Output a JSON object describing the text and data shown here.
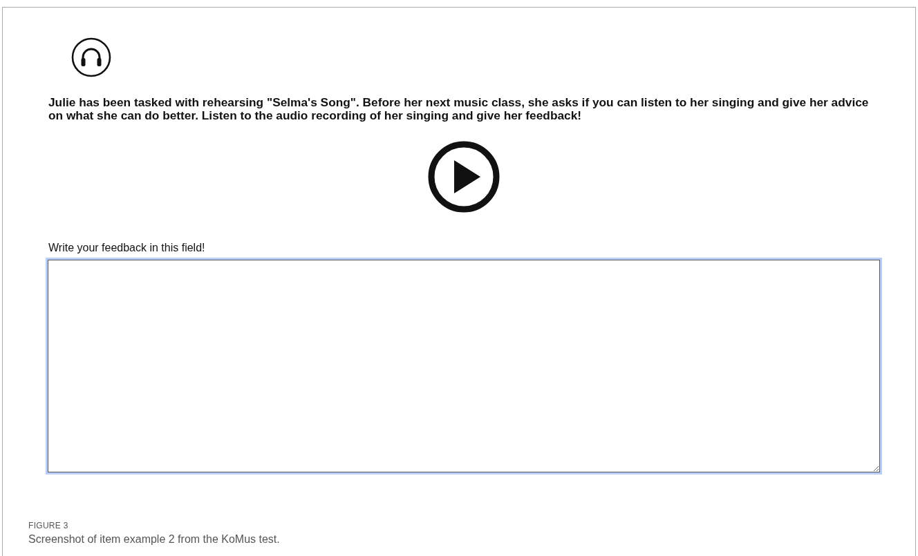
{
  "item": {
    "question": "Julie has been tasked with rehearsing \"Selma's Song\". Before her next music class, she asks if you can listen to her singing and give her advice on what she can do better. Listen to the audio recording of her singing and give her feedback!",
    "field_label": "Write your feedback in this field!"
  },
  "caption": {
    "figure_label": "FIGURE 3",
    "text": "Screenshot of item example 2 from the KoMus test."
  }
}
